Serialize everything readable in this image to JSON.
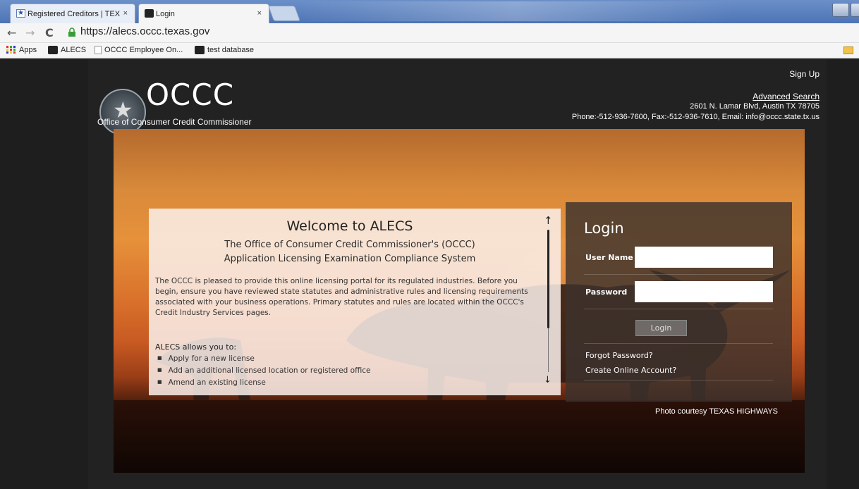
{
  "browser": {
    "tabs": [
      {
        "label": "Registered Creditors | TEX",
        "icon": "star-bookmark-icon",
        "active": false
      },
      {
        "label": "Login",
        "icon": "longhorn-icon",
        "active": true
      }
    ],
    "tab_close_glyph": "×",
    "url": "https://alecs.occc.texas.gov",
    "bookmarks": [
      {
        "label": "Apps",
        "icon": "apps-grid-icon"
      },
      {
        "label": "ALECS",
        "icon": "longhorn-icon"
      },
      {
        "label": "OCCC Employee On...",
        "icon": "page-icon"
      },
      {
        "label": "test database",
        "icon": "longhorn-icon"
      }
    ]
  },
  "header": {
    "brand": "OCCC",
    "subtitle": "Office of Consumer Credit Commissioner",
    "sign_up": "Sign Up",
    "advanced_search": "Advanced Search",
    "address": "2601 N. Lamar Blvd, Austin TX 78705",
    "contact": "Phone:-512-936-7600, Fax:-512-936-7610, Email: info@occc.state.tx.us"
  },
  "welcome": {
    "title": "Welcome to ALECS",
    "line2": "The Office of Consumer Credit Commissioner's (OCCC)",
    "line3": "Application Licensing Examination Compliance System",
    "paragraph": "The OCCC is pleased to provide this online licensing portal for its regulated industries. Before you begin, ensure you have reviewed state statutes and administrative rules and licensing requirements associated with your business operations. Primary statutes and rules are located within the OCCC's Credit Industry Services pages.",
    "allows_heading": "ALECS allows you to:",
    "items": [
      "Apply for a new license",
      "Add an additional licensed location or registered office",
      "Amend an existing license"
    ]
  },
  "login": {
    "title": "Login",
    "username_label": "User Name",
    "password_label": "Password",
    "button": "Login",
    "forgot": "Forgot Password?",
    "create": "Create Online Account?"
  },
  "photo_credit": "Photo courtesy TEXAS HIGHWAYS"
}
